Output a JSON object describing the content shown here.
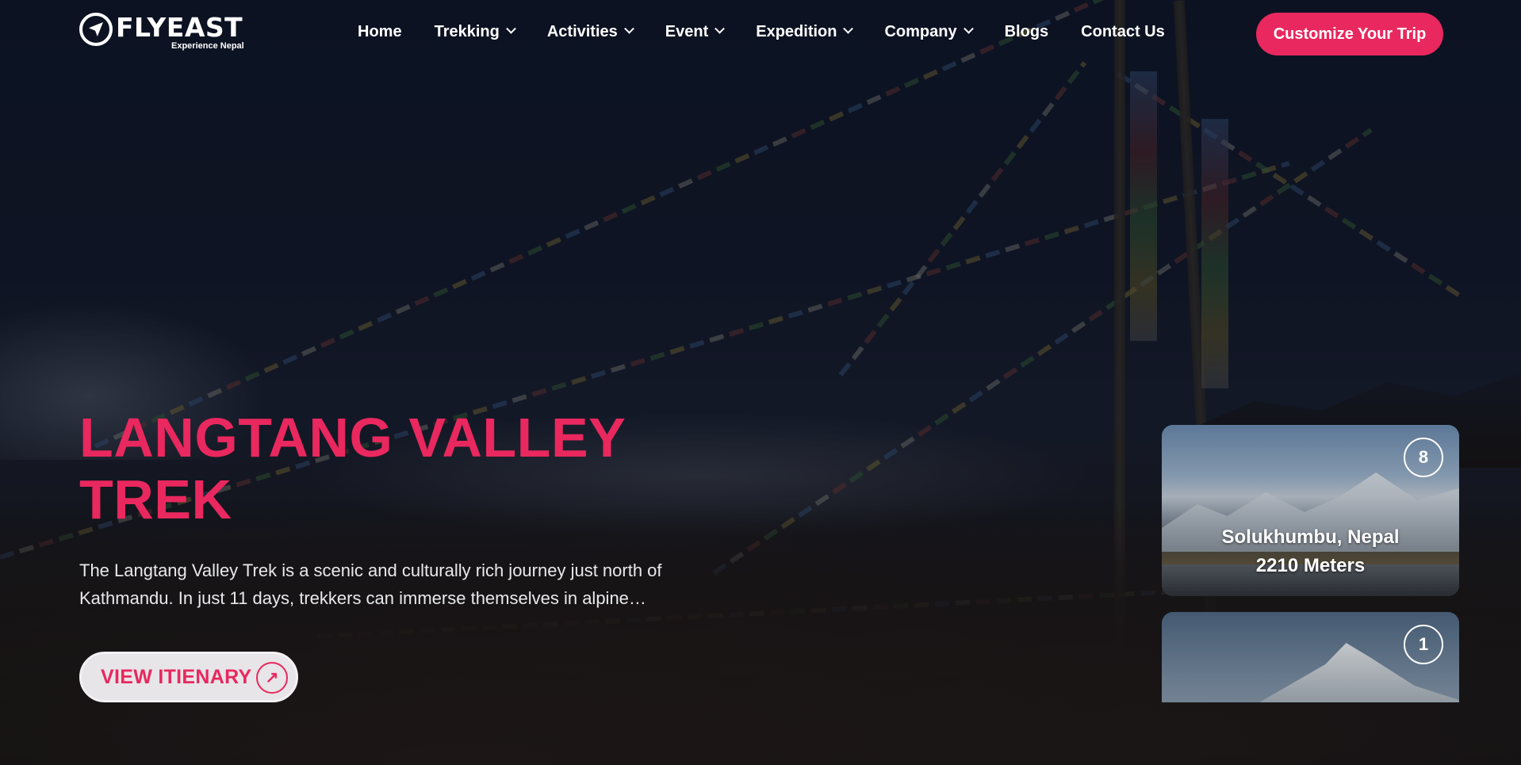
{
  "brand": {
    "name": "FLYEAST",
    "tagline": "Experience Nepal",
    "accent_color": "#e8285e"
  },
  "nav": {
    "items": [
      {
        "label": "Home",
        "has_dropdown": false
      },
      {
        "label": "Trekking",
        "has_dropdown": true
      },
      {
        "label": "Activities",
        "has_dropdown": true
      },
      {
        "label": "Event",
        "has_dropdown": true
      },
      {
        "label": "Expedition",
        "has_dropdown": true
      },
      {
        "label": "Company",
        "has_dropdown": true
      },
      {
        "label": "Blogs",
        "has_dropdown": false
      },
      {
        "label": "Contact Us",
        "has_dropdown": false
      }
    ],
    "cta_label": "Customize Your Trip"
  },
  "hero": {
    "title_line1": "LANGTANG VALLEY",
    "title_line2": "TREK",
    "description": "The Langtang Valley Trek is a scenic and culturally rich journey just north of Kathmandu. In just 11 days, trekkers can immerse themselves in alpine landscapes, Tamang culture and breathtaking Himalayan views.",
    "button_label": "VIEW ITIENARY",
    "button_icon": "arrow-up-right-icon"
  },
  "cards": [
    {
      "badge": "8",
      "location": "Solukhumbu, Nepal",
      "altitude": "2210 Meters"
    },
    {
      "badge": "1",
      "location": "",
      "altitude": ""
    }
  ]
}
